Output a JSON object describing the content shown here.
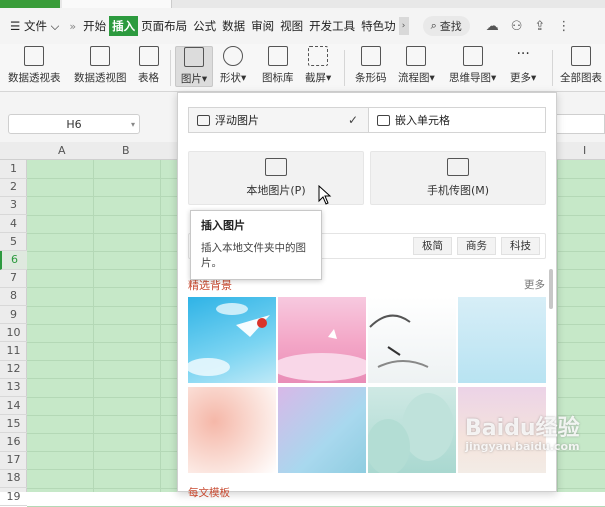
{
  "menu": {
    "file": "文件",
    "tabs": [
      "开始",
      "插入",
      "页面布局",
      "公式",
      "数据",
      "审阅",
      "视图",
      "开发工具",
      "特色功"
    ],
    "active_tab": "插入",
    "search": "查找"
  },
  "toolbar": {
    "items": [
      "数据透视表",
      "数据透视图",
      "表格",
      "图片",
      "形状",
      "图标库",
      "截屏",
      "条形码",
      "流程图",
      "思维导图",
      "更多",
      "全部图表"
    ]
  },
  "namebox": {
    "value": "H6"
  },
  "grid": {
    "columns": [
      "A",
      "B",
      "I"
    ],
    "rows": [
      "1",
      "2",
      "3",
      "4",
      "5",
      "6",
      "7",
      "8",
      "9",
      "10",
      "11",
      "12",
      "13",
      "14",
      "15",
      "16",
      "17",
      "18",
      "19"
    ],
    "selected_row": "6"
  },
  "picture_menu": {
    "mode_float": "浮动图片",
    "mode_embed": "嵌入单元格",
    "local_picture": "本地图片(P)",
    "phone_picture": "手机传图(M)",
    "tags": [
      "极简",
      "商务",
      "科技"
    ],
    "section_title": "精选背景",
    "more": "更多",
    "bottom_section": "每文模板"
  },
  "tooltip": {
    "title": "插入图片",
    "desc": "插入本地文件夹中的图片。"
  },
  "watermark": {
    "text": "Baidu经验",
    "sub": "jingyan.baidu.com"
  },
  "colors": {
    "accent": "#2c9a3e",
    "grid_bg": "#c6e8c8",
    "section": "#c84a30"
  }
}
